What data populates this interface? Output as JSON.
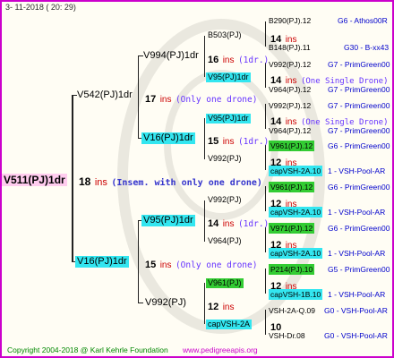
{
  "header": {
    "date": "3- 11-2018 ( 20: 29)"
  },
  "footer": {
    "copyright": "Copyright 2004-2018 @ Karl Kehrle Foundation",
    "site": "www.pedigreeapis.org"
  },
  "root": {
    "name": "V511(PJ)1dr",
    "ins": "18",
    "ins_label": "ins",
    "note": "(Insem. with only one drone)"
  },
  "gen1": [
    {
      "name": "V542(PJ)1dr",
      "ins": "17",
      "ins_label": "ins",
      "note": "(Only one drone)"
    },
    {
      "name": "V16(PJ)1dr",
      "ins": "15",
      "ins_label": "ins",
      "note": "(Only one drone)"
    }
  ],
  "gen2": [
    {
      "name": "V994(PJ)1dr",
      "ins": "16",
      "ins_label": "ins",
      "note": "(1dr.)"
    },
    {
      "name": "V16(PJ)1dr",
      "ins": "15",
      "ins_label": "ins",
      "note": "(1dr.)"
    },
    {
      "name": "V95(PJ)1dr",
      "ins": "14",
      "ins_label": "ins",
      "note": "(1dr.)"
    },
    {
      "name": "V992(PJ)",
      "ins": "12",
      "ins_label": "ins",
      "note": ""
    }
  ],
  "gen3": [
    {
      "name": "B503(PJ)",
      "ins": "14",
      "ins_label": "ins",
      "note": ""
    },
    {
      "name": "V95(PJ)1dr",
      "ins": "14",
      "ins_label": "ins",
      "note": "(One Single Drone)"
    },
    {
      "name": "V95(PJ)1dr",
      "ins": "14",
      "ins_label": "ins",
      "note": "(One Single Drone)"
    },
    {
      "name": "V992(PJ)",
      "ins": "12",
      "ins_label": "ins",
      "note": ""
    },
    {
      "name": "V992(PJ)",
      "ins": "12",
      "ins_label": "ins",
      "note": ""
    },
    {
      "name": "V964(PJ)",
      "ins": "12",
      "ins_label": "ins",
      "note": ""
    },
    {
      "name": "V961(PJ)",
      "ins": "12",
      "ins_label": "ins",
      "note": ""
    },
    {
      "name": "capVSH-2A",
      "ins": "10",
      "ins_label": "",
      "note": ""
    }
  ],
  "gen4": [
    {
      "name": "B290(PJ).12",
      "tag": "G6 - Athos00R"
    },
    {
      "name": "B148(PJ).11",
      "tag": "G30 - B-xx43"
    },
    {
      "name": "V992(PJ).12",
      "tag": "G7 - PrimGreen00"
    },
    {
      "name": "V964(PJ).12",
      "tag": "G7 - PrimGreen00"
    },
    {
      "name": "V992(PJ).12",
      "tag": "G7 - PrimGreen00"
    },
    {
      "name": "V964(PJ).12",
      "tag": "G7 - PrimGreen00"
    },
    {
      "name": "V961(PJ).12",
      "tag": "G6 - PrimGreen00"
    },
    {
      "name": "capVSH-2A.10",
      "tag": "1 - VSH-Pool-AR"
    },
    {
      "name": "V961(PJ).12",
      "tag": "G6 - PrimGreen00"
    },
    {
      "name": "capVSH-2A.10",
      "tag": "1 - VSH-Pool-AR"
    },
    {
      "name": "V971(PJ).12",
      "tag": "G6 - PrimGreen00"
    },
    {
      "name": "capVSH-2A.10",
      "tag": "1 - VSH-Pool-AR"
    },
    {
      "name": "P214(PJ).10",
      "tag": "G5 - PrimGreen00"
    },
    {
      "name": "capVSH-1B.10",
      "tag": "1 - VSH-Pool-AR"
    },
    {
      "name": "VSH-2A-Q.09",
      "tag": "G0 - VSH-Pool-AR"
    },
    {
      "name": "VSH-Dr.08",
      "tag": "G0 - VSH-Pool-AR"
    }
  ]
}
